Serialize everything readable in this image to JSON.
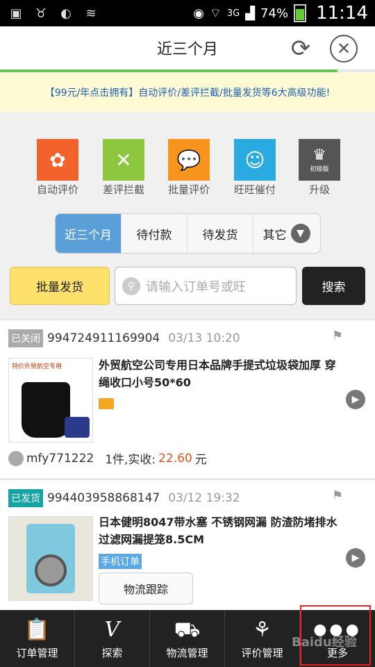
{
  "status_bar": {
    "signal_type": "3G",
    "battery": "74%",
    "time": "11:14"
  },
  "header": {
    "title": "近三个月",
    "page_progress": 0.9
  },
  "promo": {
    "text": "【99元/年点击拥有】自动评价/差评拦截/批量发货等6大高级功能!"
  },
  "features": [
    {
      "label": "自动评价",
      "color": "#f2622a",
      "icon": "flower-icon"
    },
    {
      "label": "差评拦截",
      "color": "#8dc63f",
      "icon": "shield-x-icon"
    },
    {
      "label": "批量评价",
      "color": "#f7941d",
      "icon": "chat-bubbles-icon"
    },
    {
      "label": "旺旺催付",
      "color": "#29abe2",
      "icon": "smiley-icon"
    },
    {
      "label": "升级",
      "color": "#555555",
      "icon": "crown-icon",
      "badge": "初级版"
    }
  ],
  "tabs": [
    {
      "label": "近三个月",
      "active": true
    },
    {
      "label": "待付款",
      "active": false
    },
    {
      "label": "待发货",
      "active": false
    },
    {
      "label": "其它",
      "active": false
    }
  ],
  "search": {
    "batch_label": "批量发货",
    "placeholder": "请输入订单号或旺",
    "button": "搜索"
  },
  "orders": [
    {
      "status": "已关闭",
      "status_color": "#aaaaaa",
      "order_no": "994724911169904",
      "time": "03/13 10:20",
      "title": "外贸航空公司专用日本品牌手提式垃圾袋加厚 穿绳收口小号50*60",
      "thumb_text": "特价外贸航空专用",
      "buyer": "mfy771222",
      "qty_text": "1件,实收:",
      "amount": "22.60",
      "unit": "元"
    },
    {
      "status": "已发货",
      "status_color": "#16a3a3",
      "order_no": "994403958868147",
      "time": "03/12 19:32",
      "title": "日本健明8047带水塞 不锈钢网漏 防渣防堵排水过滤网漏提笼8.5CM",
      "tag": "手机订单",
      "track": "物流跟踪"
    }
  ],
  "bottom_nav": [
    {
      "label": "订单管理",
      "icon": "clipboard-icon"
    },
    {
      "label": "探索",
      "icon": "v-icon"
    },
    {
      "label": "物流管理",
      "icon": "truck-icon"
    },
    {
      "label": "评价管理",
      "icon": "tulip-icon"
    },
    {
      "label": "更多",
      "icon": "more-dots-icon"
    }
  ],
  "watermark": "Baidu经验"
}
